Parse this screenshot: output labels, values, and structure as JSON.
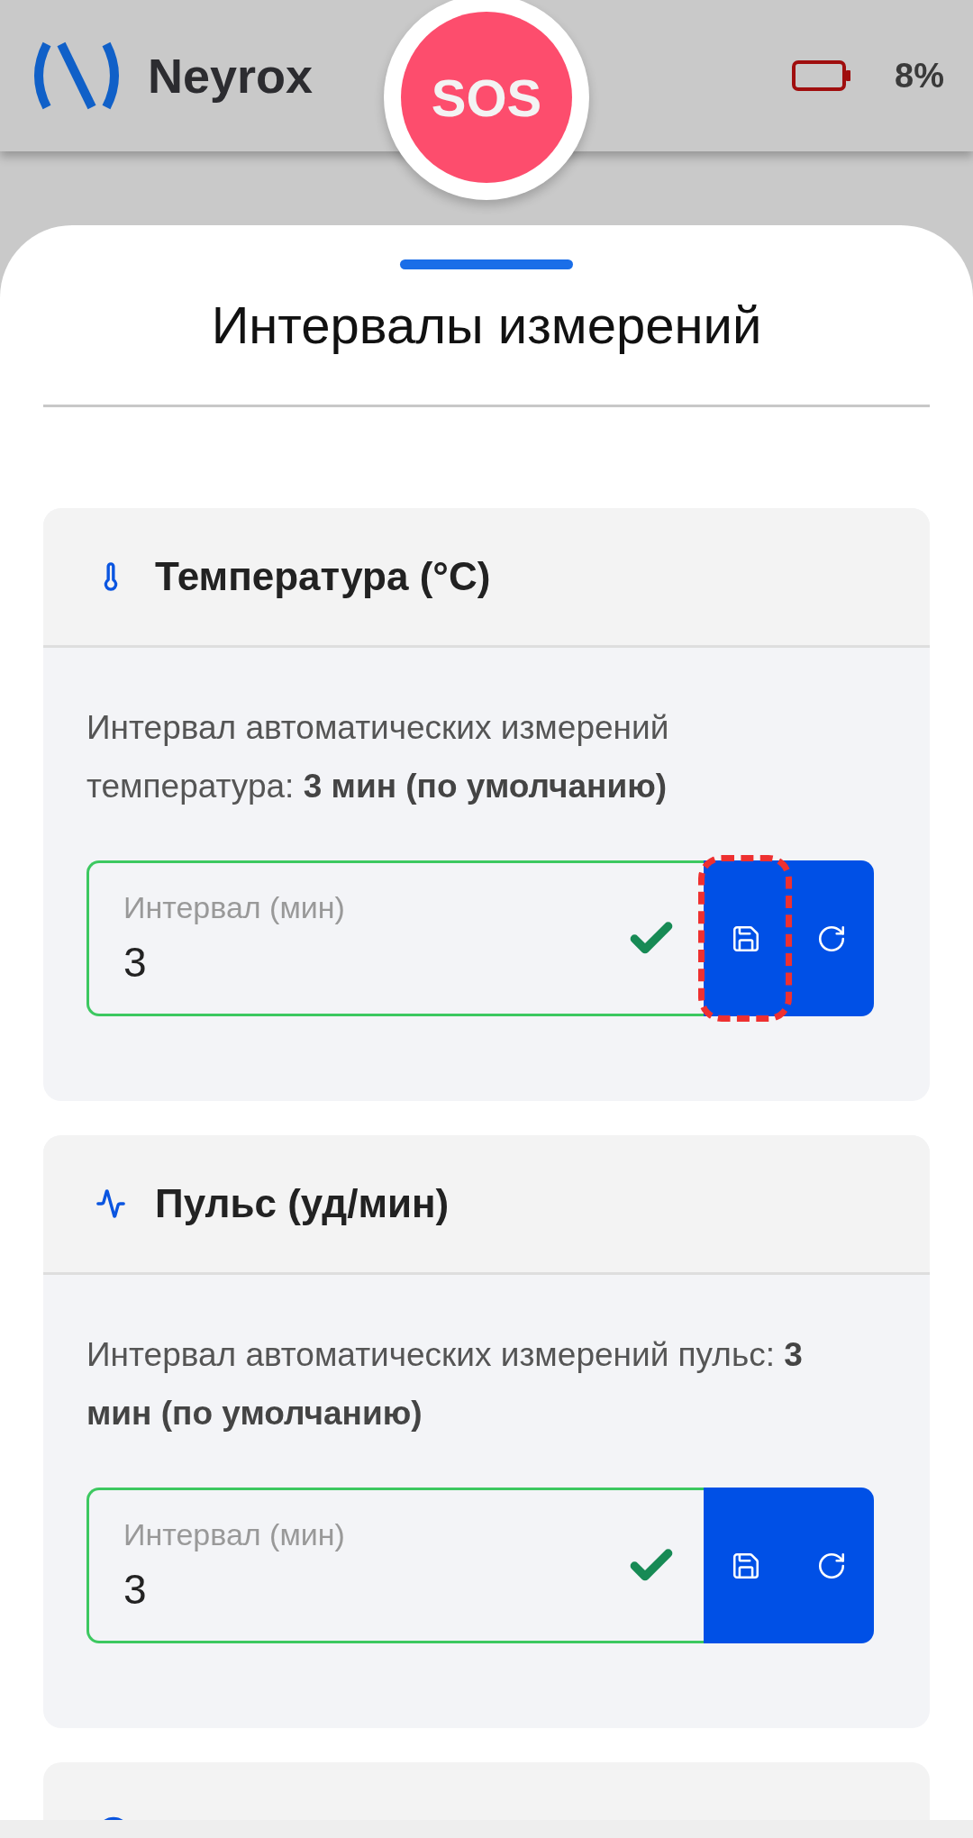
{
  "header": {
    "app_name": "Neyrox",
    "sos_label": "SOS",
    "battery": "8%"
  },
  "title": "Интервалы измерений",
  "cards": [
    {
      "kind": "full",
      "title": "Температура (°C)",
      "description": "Интервал автоматических измерений температура: **3 мин (по умолчанию)**",
      "field": {
        "label": "Интервал (мин)",
        "value": "3",
        "valid": true
      },
      "save_highlighted": true
    },
    {
      "kind": "full",
      "title": "Пульс (уд/мин)",
      "description": "Интервал автоматических измерений пульс: **3 мин (по умолчанию)**",
      "field": {
        "label": "Интервал (мин)",
        "value": "3",
        "valid": true
      },
      "save_highlighted": false
    },
    {
      "kind": "cut"
    }
  ]
}
